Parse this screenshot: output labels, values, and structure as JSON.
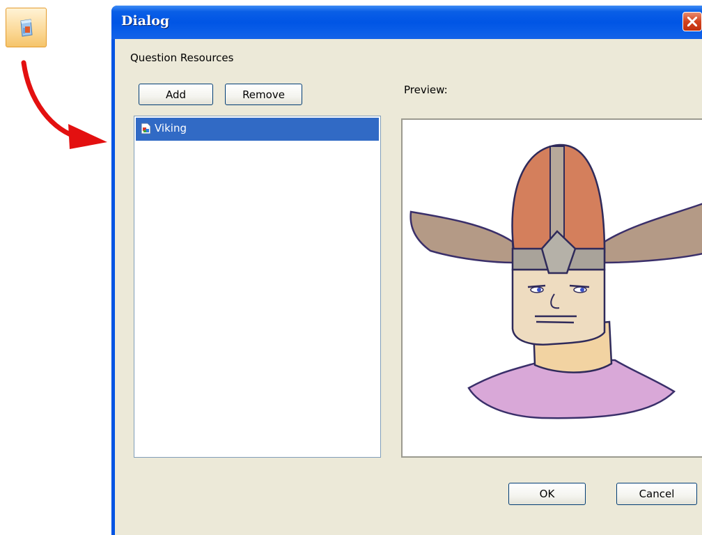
{
  "dialog": {
    "title": "Dialog",
    "group_label": "Question Resources",
    "add_label": "Add",
    "remove_label": "Remove",
    "preview_label": "Preview:",
    "ok_label": "OK",
    "cancel_label": "Cancel"
  },
  "resources": [
    {
      "name": "Viking",
      "selected": true,
      "icon": "image-file-icon"
    }
  ],
  "toolbar": {
    "icon": "resources-icon"
  },
  "annotation": {
    "icon": "red-curved-arrow",
    "color": "#e31010"
  },
  "colors": {
    "titlebar": "#0055e5",
    "selection": "#316ac5",
    "client_bg": "#ece9d8",
    "close": "#d3421e"
  }
}
